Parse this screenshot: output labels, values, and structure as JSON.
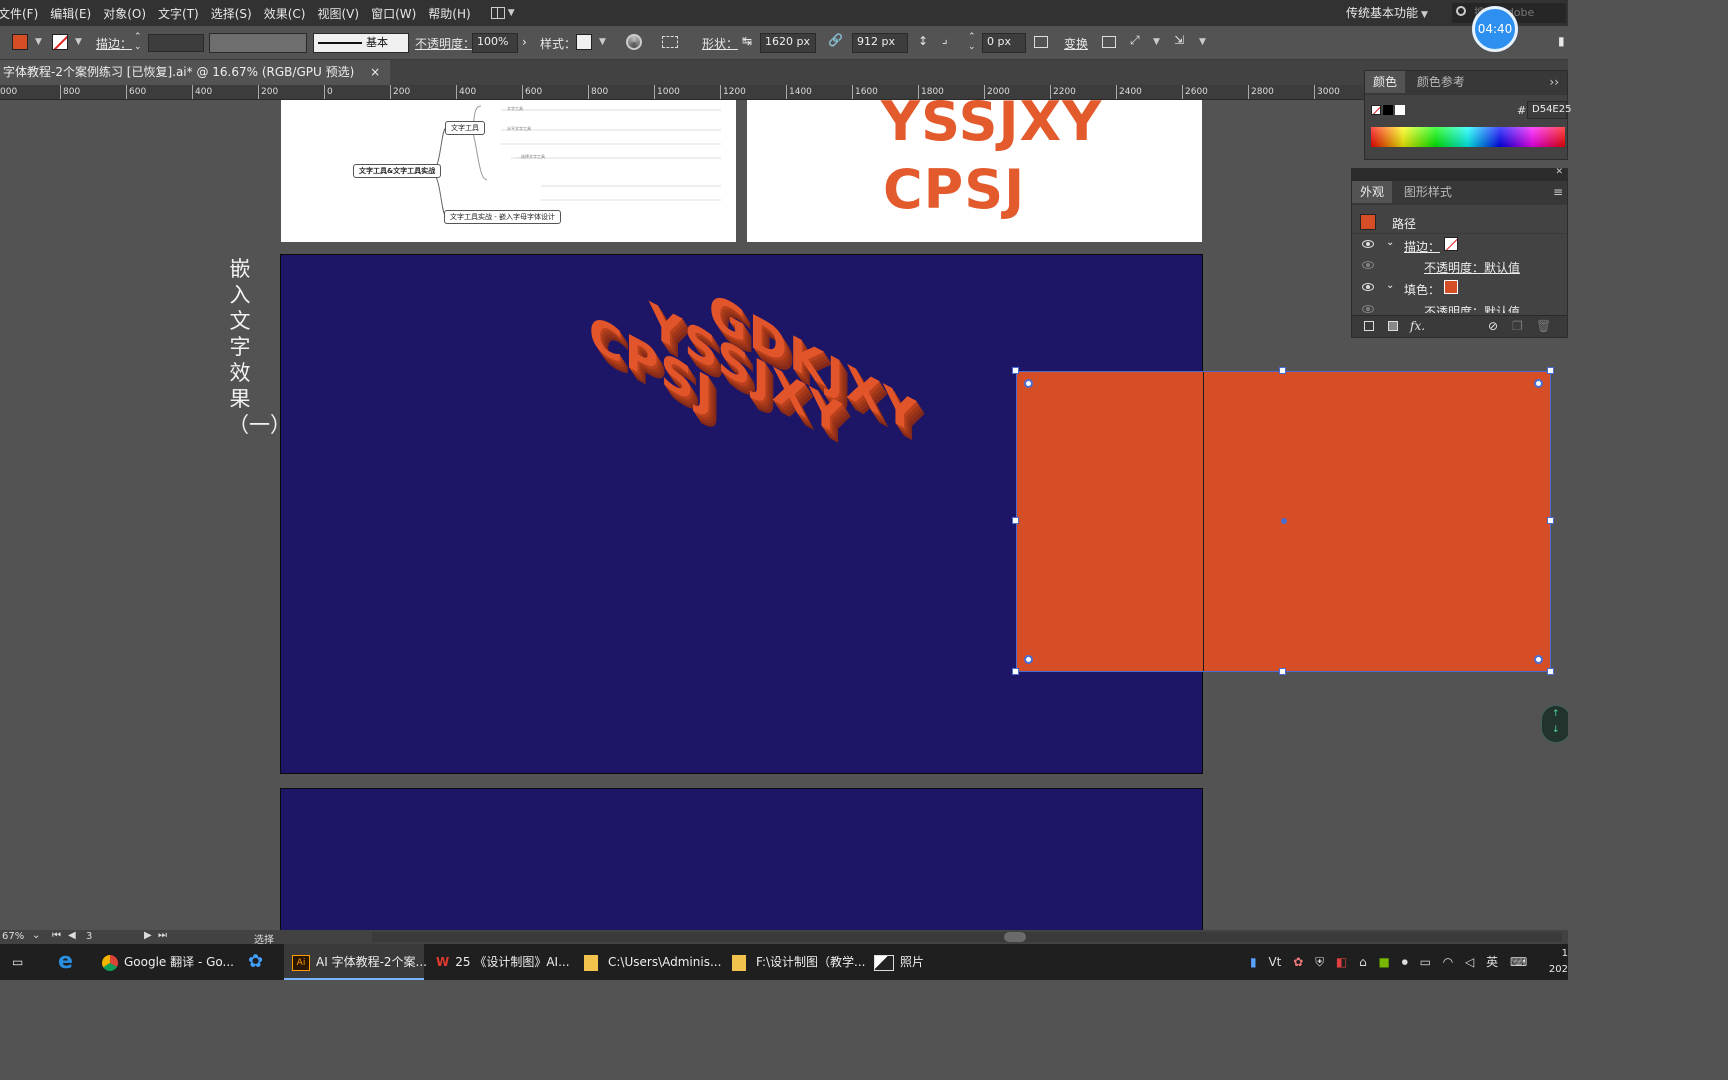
{
  "menu": {
    "items": [
      "文件(F)",
      "编辑(E)",
      "对象(O)",
      "文字(T)",
      "选择(S)",
      "效果(C)",
      "视图(V)",
      "窗口(W)",
      "帮助(H)"
    ],
    "workspace": "传统基本功能",
    "search_placeholder": "搜索 Adobe Stock"
  },
  "timer": "04:40",
  "control": {
    "stroke_label": "描边：",
    "stroke_style": "基本",
    "opacity_label": "不透明度：",
    "opacity_value": "100%",
    "style_label": "样式：",
    "shape_label": "形状：",
    "width_value": "1620 px",
    "height_value": "912 px",
    "corner_value": "0 px",
    "transform_label": "变换",
    "fill_color": "#D54E25"
  },
  "document": {
    "tab_title": "字体教程-2个案例练习 [已恢复].ai* @ 16.67% (RGB/GPU 预选)",
    "close": "×"
  },
  "ruler": {
    "ticks": [
      "000",
      "800",
      "600",
      "400",
      "200",
      "0",
      "200",
      "400",
      "600",
      "800",
      "1000",
      "1200",
      "1400",
      "1600",
      "1800",
      "2000",
      "2200",
      "2400",
      "2600",
      "2800",
      "3000"
    ]
  },
  "canvas": {
    "vertical_title": "嵌入文字效果（一）",
    "mindmap": {
      "root": "文字工具&文字工具实战",
      "node_top": "文字工具",
      "node_bottom": "文字工具实战 - 嵌入字母字体设计",
      "leaf_texts": [
        "文字工具",
        "水平文字工具",
        "…选择文字工具"
      ]
    },
    "logo_line1": "YSSJXY",
    "logo_line2": "CPSJ",
    "iso_line1": "GDKJXY",
    "iso_line2": "YSSJXY",
    "iso_line3": "CPSJ",
    "selection_color": "#D54E25"
  },
  "color_panel": {
    "tabs": [
      "颜色",
      "颜色参考"
    ],
    "hex_label": "#",
    "hex_value": "D54E25"
  },
  "appearance_panel": {
    "tabs": [
      "外观",
      "图形样式"
    ],
    "object_label": "路径",
    "stroke_label": "描边：",
    "opacity_default": "不透明度：默认值",
    "fill_label": "填色：",
    "opacity_default2": "不透明度：默认值",
    "fx_label": "fx."
  },
  "status": {
    "zoom": "67%",
    "page": "3",
    "mode": "选择"
  },
  "taskbar": {
    "items": [
      {
        "label": "Google 翻译 - Go..."
      },
      {
        "label": "AI 字体教程-2个案..."
      },
      {
        "label": "25 《设计制图》AI..."
      },
      {
        "label": "C:\\Users\\Adminis..."
      },
      {
        "label": "F:\\设计制图（教学..."
      },
      {
        "label": "照片"
      }
    ],
    "ime": "英",
    "clock_top": "1",
    "clock_bottom": "202"
  }
}
